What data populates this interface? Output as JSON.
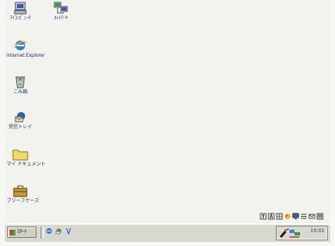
{
  "desktop": {
    "icons": [
      {
        "name": "my-computer",
        "label": "ﾏｲｺﾝﾋﾟｭｰﾀ"
      },
      {
        "name": "network",
        "label": "ﾈｯﾄﾜｰｸ"
      },
      {
        "name": "internet-explorer",
        "label": "Internet Explorer"
      },
      {
        "name": "recycle-bin",
        "label": "ごみ箱"
      },
      {
        "name": "outlook-express",
        "label": "受信トレイ"
      },
      {
        "name": "my-documents",
        "label": "マイ ドキュメント"
      },
      {
        "name": "briefcase",
        "label": "ブリーフケース"
      }
    ]
  },
  "taskbar": {
    "start_label": "ｽﾀｰﾄ",
    "clock": "10:01"
  },
  "colors": {
    "desktop": "#f2f2ee",
    "taskbar": "#d8d8d0",
    "label": "#2a3b6a"
  }
}
